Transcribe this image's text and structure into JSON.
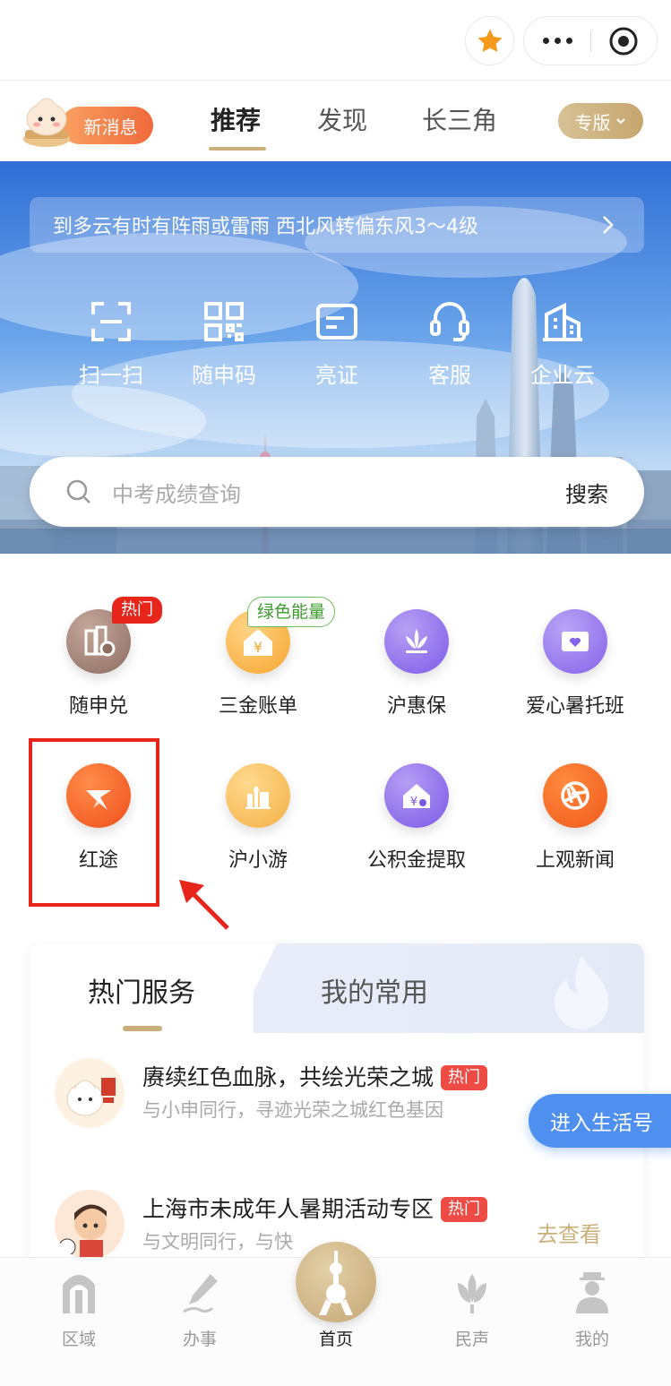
{
  "topbar": {
    "star_icon": "star-icon",
    "more_icon": "more-dots-icon",
    "close_icon": "target-close-icon"
  },
  "nav": {
    "new_msg": "新消息",
    "tabs": [
      "推荐",
      "发现",
      "长三角"
    ],
    "active_tab": "推荐",
    "zhuanban": "专版"
  },
  "hero": {
    "weather": "到多云有时有阵雨或雷雨 西北风转偏东风3～4级",
    "quick_actions": [
      "扫一扫",
      "随申码",
      "亮证",
      "客服",
      "企业云"
    ],
    "search_placeholder": "中考成绩查询",
    "search_button": "搜索"
  },
  "grid": [
    {
      "label": "随申兑",
      "badge": "热门"
    },
    {
      "label": "三金账单",
      "badge": "绿色能量"
    },
    {
      "label": "沪惠保"
    },
    {
      "label": "爱心暑托班"
    },
    {
      "label": "红途"
    },
    {
      "label": "沪小游"
    },
    {
      "label": "公积金提取"
    },
    {
      "label": "上观新闻"
    }
  ],
  "services": {
    "tabs": [
      "热门服务",
      "我的常用"
    ],
    "items": [
      {
        "title": "赓续红色血脉，共绘光荣之城",
        "tag": "热门",
        "subtitle": "与小申同行，寻迹光荣之城红色基因"
      },
      {
        "title": "上海市未成年人暑期活动专区",
        "tag": "热门",
        "subtitle": "与文明同行，与快",
        "action": "去查看"
      }
    ],
    "life_button": "进入生活号"
  },
  "bottom_nav": [
    "区域",
    "办事",
    "首页",
    "民声",
    "我的"
  ],
  "colors": {
    "accent_gold": "#c9b07a",
    "hot_red": "#e8251a",
    "life_blue": "#4f8ff0"
  }
}
